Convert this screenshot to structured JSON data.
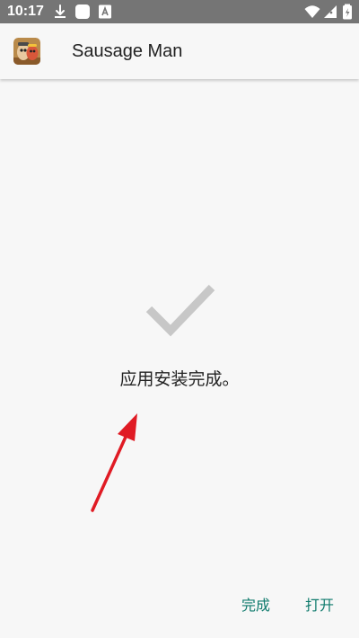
{
  "status_bar": {
    "time": "10:17",
    "icons": [
      "download-icon",
      "app-notification-icon",
      "app-a-icon",
      "wifi-icon",
      "signal-icon",
      "battery-icon"
    ],
    "color": "#757575"
  },
  "app_bar": {
    "title": "Sausage Man",
    "icon": "sausage-man-app-icon"
  },
  "main": {
    "status_icon": "check-icon",
    "message": "应用安装完成。",
    "annotation": "red-arrow-pointing-up"
  },
  "actions": {
    "done_label": "完成",
    "open_label": "打开"
  },
  "colors": {
    "accent": "#0e7a6c",
    "check": "#c7c7c7",
    "arrow": "#e01b24",
    "background": "#f7f7f7"
  }
}
